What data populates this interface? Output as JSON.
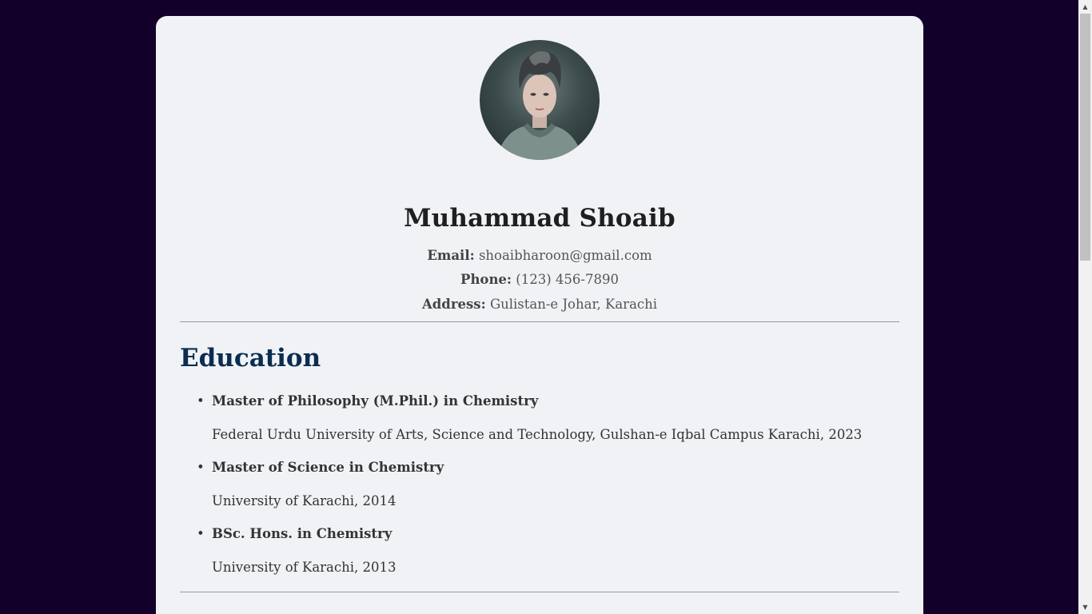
{
  "profile": {
    "name": "Muhammad Shoaib",
    "email_label": "Email:",
    "email": "shoaibharoon@gmail.com",
    "phone_label": "Phone:",
    "phone": "(123) 456-7890",
    "address_label": "Address:",
    "address": "Gulistan-e Johar, Karachi"
  },
  "education": {
    "title": "Education",
    "items": [
      {
        "degree": "Master of Philosophy (M.Phil.) in Chemistry",
        "institution": "Federal Urdu University of Arts, Science and Technology, Gulshan-e Iqbal Campus Karachi, 2023"
      },
      {
        "degree": "Master of Science in Chemistry",
        "institution": "University of Karachi, 2014"
      },
      {
        "degree": "BSc. Hons. in Chemistry",
        "institution": "University of Karachi, 2013"
      }
    ]
  },
  "colors": {
    "page_background": "#13002a",
    "card_background": "#f0f2f5",
    "section_heading": "#0b2d52"
  }
}
